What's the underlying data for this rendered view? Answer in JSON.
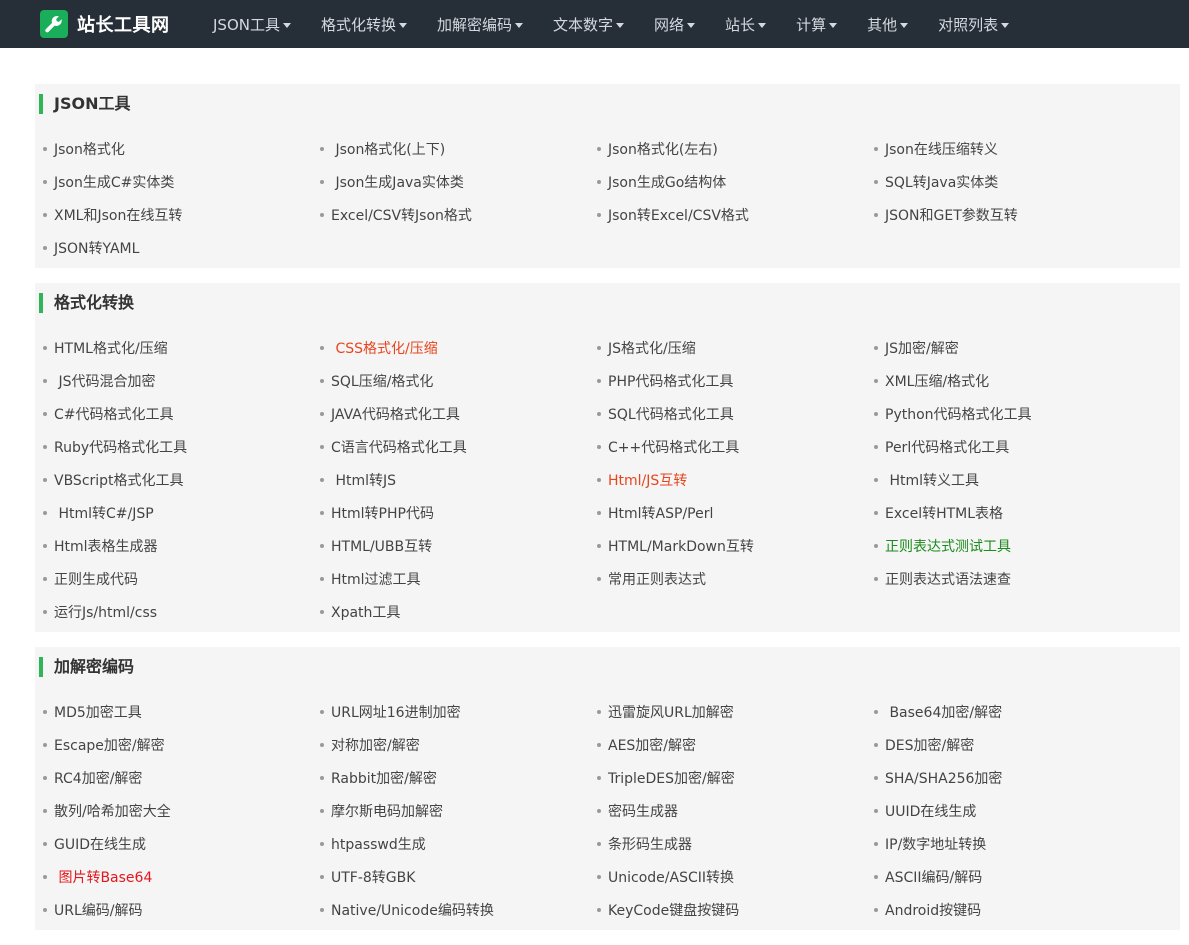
{
  "header": {
    "site_title": "站长工具网",
    "logo_icon": "wrench-icon",
    "brand_color": "#1aad5a",
    "nav": [
      {
        "label": "JSON工具"
      },
      {
        "label": "格式化转换"
      },
      {
        "label": "加解密编码"
      },
      {
        "label": "文本数字"
      },
      {
        "label": "网络"
      },
      {
        "label": "站长"
      },
      {
        "label": "计算"
      },
      {
        "label": "其他"
      },
      {
        "label": "对照列表"
      }
    ]
  },
  "accent_color": "#2fb457",
  "sections": [
    {
      "title": "JSON工具",
      "tools": [
        {
          "label": "Json格式化"
        },
        {
          "label": " Json格式化(上下)"
        },
        {
          "label": "Json格式化(左右)"
        },
        {
          "label": "Json在线压缩转义"
        },
        {
          "label": "Json生成C#实体类"
        },
        {
          "label": " Json生成Java实体类"
        },
        {
          "label": "Json生成Go结构体"
        },
        {
          "label": "SQL转Java实体类"
        },
        {
          "label": "XML和Json在线互转"
        },
        {
          "label": "Excel/CSV转Json格式"
        },
        {
          "label": "Json转Excel/CSV格式"
        },
        {
          "label": "JSON和GET参数互转"
        },
        {
          "label": "JSON转YAML"
        }
      ]
    },
    {
      "title": "格式化转换",
      "tools": [
        {
          "label": "HTML格式化/压缩"
        },
        {
          "label": " CSS格式化/压缩",
          "color": "orange"
        },
        {
          "label": "JS格式化/压缩"
        },
        {
          "label": "JS加密/解密"
        },
        {
          "label": " JS代码混合加密"
        },
        {
          "label": "SQL压缩/格式化"
        },
        {
          "label": "PHP代码格式化工具"
        },
        {
          "label": "XML压缩/格式化"
        },
        {
          "label": "C#代码格式化工具"
        },
        {
          "label": "JAVA代码格式化工具"
        },
        {
          "label": "SQL代码格式化工具"
        },
        {
          "label": "Python代码格式化工具"
        },
        {
          "label": "Ruby代码格式化工具"
        },
        {
          "label": "C语言代码格式化工具"
        },
        {
          "label": "C++代码格式化工具"
        },
        {
          "label": "Perl代码格式化工具"
        },
        {
          "label": "VBScript格式化工具"
        },
        {
          "label": " Html转JS"
        },
        {
          "label": "Html/JS互转",
          "color": "orange"
        },
        {
          "label": " Html转义工具"
        },
        {
          "label": " Html转C#/JSP"
        },
        {
          "label": "Html转PHP代码"
        },
        {
          "label": "Html转ASP/Perl"
        },
        {
          "label": "Excel转HTML表格"
        },
        {
          "label": "Html表格生成器"
        },
        {
          "label": "HTML/UBB互转"
        },
        {
          "label": "HTML/MarkDown互转"
        },
        {
          "label": "正则表达式测试工具",
          "color": "green"
        },
        {
          "label": "正则生成代码"
        },
        {
          "label": "Html过滤工具"
        },
        {
          "label": "常用正则表达式"
        },
        {
          "label": "正则表达式语法速查"
        },
        {
          "label": "运行Js/html/css"
        },
        {
          "label": "Xpath工具"
        }
      ]
    },
    {
      "title": "加解密编码",
      "tools": [
        {
          "label": "MD5加密工具"
        },
        {
          "label": "URL网址16进制加密"
        },
        {
          "label": "迅雷旋风URL加解密"
        },
        {
          "label": " Base64加密/解密"
        },
        {
          "label": "Escape加密/解密"
        },
        {
          "label": "对称加密/解密"
        },
        {
          "label": "AES加密/解密"
        },
        {
          "label": "DES加密/解密"
        },
        {
          "label": "RC4加密/解密"
        },
        {
          "label": "Rabbit加密/解密"
        },
        {
          "label": "TripleDES加密/解密"
        },
        {
          "label": "SHA/SHA256加密"
        },
        {
          "label": "散列/哈希加密大全"
        },
        {
          "label": "摩尔斯电码加解密"
        },
        {
          "label": "密码生成器"
        },
        {
          "label": "UUID在线生成"
        },
        {
          "label": "GUID在线生成"
        },
        {
          "label": "htpasswd生成"
        },
        {
          "label": "条形码生成器"
        },
        {
          "label": "IP/数字地址转换"
        },
        {
          "label": " 图片转Base64",
          "color": "red"
        },
        {
          "label": "UTF-8转GBK"
        },
        {
          "label": "Unicode/ASCII转换"
        },
        {
          "label": "ASCII编码/解码"
        },
        {
          "label": "URL编码/解码"
        },
        {
          "label": "Native/Unicode编码转换"
        },
        {
          "label": "KeyCode键盘按键码"
        },
        {
          "label": "Android按键码"
        }
      ]
    }
  ]
}
